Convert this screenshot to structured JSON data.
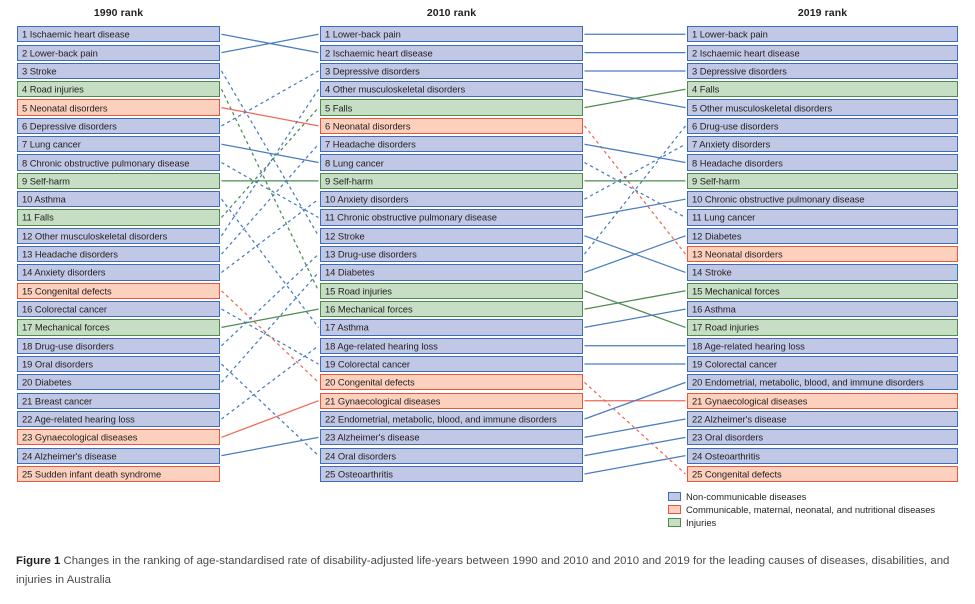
{
  "figure": {
    "caption_label": "Figure 1",
    "caption_text": "Changes in the ranking of age-standardised rate of disability-adjusted life-years between 1990 and 2010 and 2010 and 2019 for the leading causes of diseases, disabilities, and injuries in Australia"
  },
  "colors": {
    "ncd_fill": "#c0c8e6",
    "ncd_border": "#3f6cb6",
    "cmnn_fill": "#fbd0bd",
    "cmnn_border": "#ea5540",
    "inj_fill": "#c5dec4",
    "inj_border": "#4f8b50",
    "link_blue": "#4a7cc0",
    "link_red": "#ef6a54",
    "link_green": "#4f8b50"
  },
  "legend": {
    "items": [
      {
        "label": "Non-communicable diseases",
        "category": "ncd"
      },
      {
        "label": "Communicable, maternal, neonatal, and nutritional diseases",
        "category": "cmnn"
      },
      {
        "label": "Injuries",
        "category": "inj"
      }
    ]
  },
  "chart_data": {
    "type": "table",
    "title": "Changes in the ranking of age-standardised rate of disability-adjusted life-years between 1990 and 2010 and 2010 and 2019 for the leading causes of diseases, disabilities, and injuries in Australia",
    "columns": [
      {
        "header": "1990 rank",
        "year": 1990,
        "items": [
          {
            "rank": 1,
            "cause": "Ischaemic heart disease",
            "category": "ncd"
          },
          {
            "rank": 2,
            "cause": "Lower-back pain",
            "category": "ncd"
          },
          {
            "rank": 3,
            "cause": "Stroke",
            "category": "ncd"
          },
          {
            "rank": 4,
            "cause": "Road injuries",
            "category": "inj"
          },
          {
            "rank": 5,
            "cause": "Neonatal disorders",
            "category": "cmnn"
          },
          {
            "rank": 6,
            "cause": "Depressive disorders",
            "category": "ncd"
          },
          {
            "rank": 7,
            "cause": "Lung cancer",
            "category": "ncd"
          },
          {
            "rank": 8,
            "cause": "Chronic obstructive pulmonary disease",
            "category": "ncd"
          },
          {
            "rank": 9,
            "cause": "Self-harm",
            "category": "inj"
          },
          {
            "rank": 10,
            "cause": "Asthma",
            "category": "ncd"
          },
          {
            "rank": 11,
            "cause": "Falls",
            "category": "inj"
          },
          {
            "rank": 12,
            "cause": "Other musculoskeletal disorders",
            "category": "ncd"
          },
          {
            "rank": 13,
            "cause": "Headache disorders",
            "category": "ncd"
          },
          {
            "rank": 14,
            "cause": "Anxiety disorders",
            "category": "ncd"
          },
          {
            "rank": 15,
            "cause": "Congenital defects",
            "category": "cmnn"
          },
          {
            "rank": 16,
            "cause": "Colorectal cancer",
            "category": "ncd"
          },
          {
            "rank": 17,
            "cause": "Mechanical forces",
            "category": "inj"
          },
          {
            "rank": 18,
            "cause": "Drug-use disorders",
            "category": "ncd"
          },
          {
            "rank": 19,
            "cause": "Oral disorders",
            "category": "ncd"
          },
          {
            "rank": 20,
            "cause": "Diabetes",
            "category": "ncd"
          },
          {
            "rank": 21,
            "cause": "Breast cancer",
            "category": "ncd"
          },
          {
            "rank": 22,
            "cause": "Age-related hearing loss",
            "category": "ncd"
          },
          {
            "rank": 23,
            "cause": "Gynaecological diseases",
            "category": "cmnn"
          },
          {
            "rank": 24,
            "cause": "Alzheimer's disease",
            "category": "ncd"
          },
          {
            "rank": 25,
            "cause": "Sudden infant death syndrome",
            "category": "cmnn"
          }
        ]
      },
      {
        "header": "2010 rank",
        "year": 2010,
        "items": [
          {
            "rank": 1,
            "cause": "Lower-back pain",
            "category": "ncd"
          },
          {
            "rank": 2,
            "cause": "Ischaemic heart disease",
            "category": "ncd"
          },
          {
            "rank": 3,
            "cause": "Depressive disorders",
            "category": "ncd"
          },
          {
            "rank": 4,
            "cause": "Other musculoskeletal disorders",
            "category": "ncd"
          },
          {
            "rank": 5,
            "cause": "Falls",
            "category": "inj"
          },
          {
            "rank": 6,
            "cause": "Neonatal disorders",
            "category": "cmnn"
          },
          {
            "rank": 7,
            "cause": "Headache disorders",
            "category": "ncd"
          },
          {
            "rank": 8,
            "cause": "Lung cancer",
            "category": "ncd"
          },
          {
            "rank": 9,
            "cause": "Self-harm",
            "category": "inj"
          },
          {
            "rank": 10,
            "cause": "Anxiety disorders",
            "category": "ncd"
          },
          {
            "rank": 11,
            "cause": "Chronic obstructive pulmonary disease",
            "category": "ncd"
          },
          {
            "rank": 12,
            "cause": "Stroke",
            "category": "ncd"
          },
          {
            "rank": 13,
            "cause": "Drug-use disorders",
            "category": "ncd"
          },
          {
            "rank": 14,
            "cause": "Diabetes",
            "category": "ncd"
          },
          {
            "rank": 15,
            "cause": "Road injuries",
            "category": "inj"
          },
          {
            "rank": 16,
            "cause": "Mechanical forces",
            "category": "inj"
          },
          {
            "rank": 17,
            "cause": "Asthma",
            "category": "ncd"
          },
          {
            "rank": 18,
            "cause": "Age-related hearing loss",
            "category": "ncd"
          },
          {
            "rank": 19,
            "cause": "Colorectal cancer",
            "category": "ncd"
          },
          {
            "rank": 20,
            "cause": "Congenital defects",
            "category": "cmnn"
          },
          {
            "rank": 21,
            "cause": "Gynaecological diseases",
            "category": "cmnn"
          },
          {
            "rank": 22,
            "cause": "Endometrial, metabolic, blood, and immune disorders",
            "category": "ncd"
          },
          {
            "rank": 23,
            "cause": "Alzheimer's disease",
            "category": "ncd"
          },
          {
            "rank": 24,
            "cause": "Oral disorders",
            "category": "ncd"
          },
          {
            "rank": 25,
            "cause": "Osteoarthritis",
            "category": "ncd"
          }
        ]
      },
      {
        "header": "2019 rank",
        "year": 2019,
        "items": [
          {
            "rank": 1,
            "cause": "Lower-back pain",
            "category": "ncd"
          },
          {
            "rank": 2,
            "cause": "Ischaemic heart disease",
            "category": "ncd"
          },
          {
            "rank": 3,
            "cause": "Depressive disorders",
            "category": "ncd"
          },
          {
            "rank": 4,
            "cause": "Falls",
            "category": "inj"
          },
          {
            "rank": 5,
            "cause": "Other musculoskeletal disorders",
            "category": "ncd"
          },
          {
            "rank": 6,
            "cause": "Drug-use disorders",
            "category": "ncd"
          },
          {
            "rank": 7,
            "cause": "Anxiety disorders",
            "category": "ncd"
          },
          {
            "rank": 8,
            "cause": "Headache disorders",
            "category": "ncd"
          },
          {
            "rank": 9,
            "cause": "Self-harm",
            "category": "inj"
          },
          {
            "rank": 10,
            "cause": "Chronic obstructive pulmonary disease",
            "category": "ncd"
          },
          {
            "rank": 11,
            "cause": "Lung cancer",
            "category": "ncd"
          },
          {
            "rank": 12,
            "cause": "Diabetes",
            "category": "ncd"
          },
          {
            "rank": 13,
            "cause": "Neonatal disorders",
            "category": "cmnn"
          },
          {
            "rank": 14,
            "cause": "Stroke",
            "category": "ncd"
          },
          {
            "rank": 15,
            "cause": "Mechanical forces",
            "category": "inj"
          },
          {
            "rank": 16,
            "cause": "Asthma",
            "category": "ncd"
          },
          {
            "rank": 17,
            "cause": "Road injuries",
            "category": "inj"
          },
          {
            "rank": 18,
            "cause": "Age-related hearing loss",
            "category": "ncd"
          },
          {
            "rank": 19,
            "cause": "Colorectal cancer",
            "category": "ncd"
          },
          {
            "rank": 20,
            "cause": "Endometrial, metabolic, blood, and immune disorders",
            "category": "ncd"
          },
          {
            "rank": 21,
            "cause": "Gynaecological diseases",
            "category": "cmnn"
          },
          {
            "rank": 22,
            "cause": "Alzheimer's disease",
            "category": "ncd"
          },
          {
            "rank": 23,
            "cause": "Oral disorders",
            "category": "ncd"
          },
          {
            "rank": 24,
            "cause": "Osteoarthritis",
            "category": "ncd"
          },
          {
            "rank": 25,
            "cause": "Congenital defects",
            "category": "cmnn"
          }
        ]
      }
    ]
  }
}
